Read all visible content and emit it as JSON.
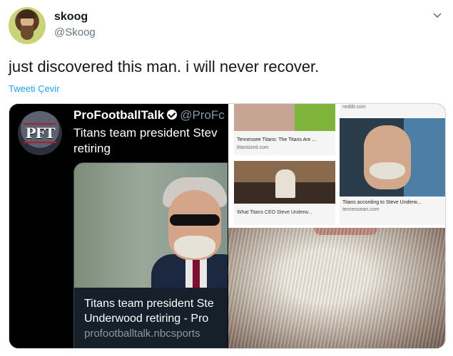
{
  "user": {
    "display_name": "skoog",
    "handle": "@Skoog"
  },
  "tweet": {
    "text": "just discovered this man. i will never recover.",
    "translate_label": "Tweeti Çevir"
  },
  "icons": {
    "menu": "chevron-down-icon",
    "verified": "verified-icon"
  },
  "colors": {
    "link": "#1da1f2",
    "muted": "#657786"
  },
  "embedded_tweet": {
    "logo_text": "PFT",
    "name": "ProFootballTalk",
    "handle": "@ProFc",
    "text": "Titans team president Stev retiring",
    "card": {
      "title_line1": "Titans team president Ste",
      "title_line2": "Underwood retiring - Pro",
      "domain": "profootballtalk.nbcsports"
    }
  },
  "image_results": [
    {
      "caption": "Tennessee Titans: The Titans Are ...",
      "source": "titansized.com"
    },
    {
      "caption": "What Titans CEO Steve Underw..."
    },
    {
      "source": "reddit.com"
    },
    {
      "caption": "Titans according to Steve Underw...",
      "source": "tennessean.com"
    }
  ]
}
